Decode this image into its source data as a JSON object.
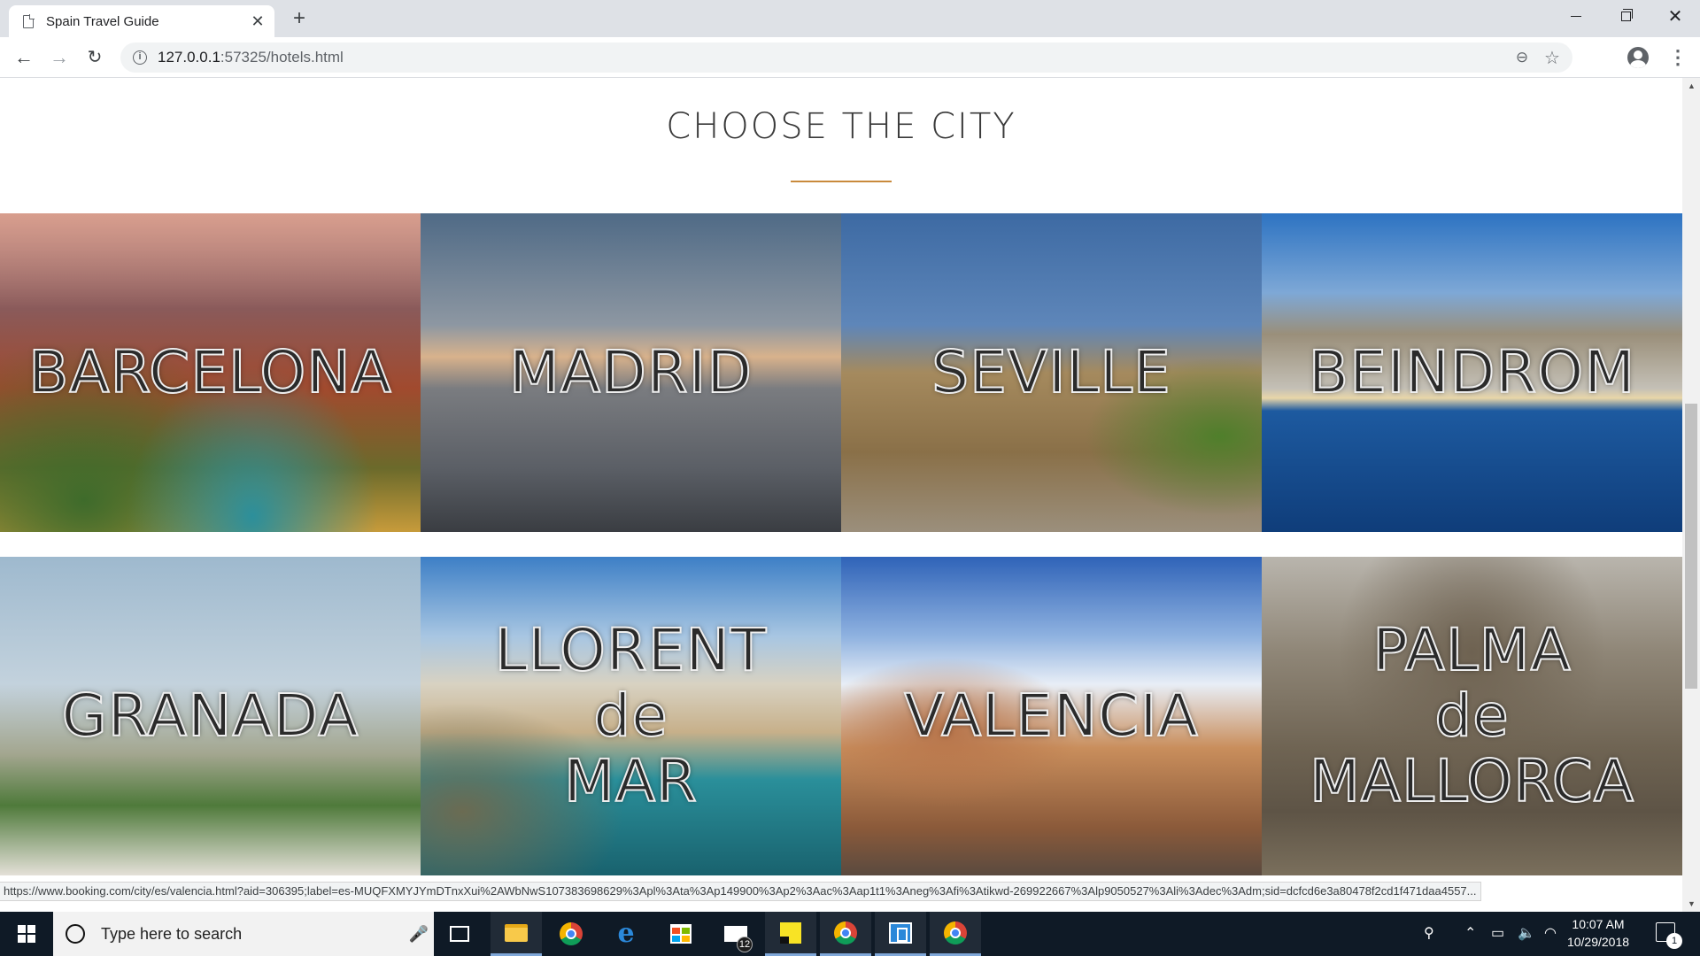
{
  "browser": {
    "tab_title": "Spain Travel Guide",
    "tab_close": "✕",
    "new_tab": "+",
    "window_close": "✕",
    "url_host": "127.0.0.1",
    "url_rest": ":57325/hotels.html",
    "status_url": "https://www.booking.com/city/es/valencia.html?aid=306395;label=es-MUQFXMYJYmDTnxXui%2AWbNwS107383698629%3Apl%3Ata%3Ap149900%3Ap2%3Aac%3Aap1t1%3Aneg%3Afi%3Atikwd-269922667%3Alp9050527%3Ali%3Adec%3Adm;sid=dcfcd6e3a80478f2cd1f471daa4557..."
  },
  "page": {
    "heading": "CHOOSE THE CITY",
    "accent_color": "#c98a3c",
    "cities": [
      {
        "name": "BARCELONA"
      },
      {
        "name": "MADRID"
      },
      {
        "name": "SEVILLE"
      },
      {
        "name": "BEINDROM"
      },
      {
        "name": "GRANADA"
      },
      {
        "name": "LLORENT\nde\nMAR"
      },
      {
        "name": "VALENCIA"
      },
      {
        "name": "PALMA\nde\nMALLORCA"
      }
    ]
  },
  "taskbar": {
    "search_placeholder": "Type here to search",
    "mail_badge": "12",
    "clock_time": "10:07 AM",
    "clock_date": "10/29/2018",
    "notification_count": "1",
    "apps": [
      "task-view",
      "file-explorer",
      "chrome",
      "edge",
      "store",
      "mail",
      "sticky-notes",
      "chrome",
      "remote-desktop",
      "chrome"
    ]
  }
}
